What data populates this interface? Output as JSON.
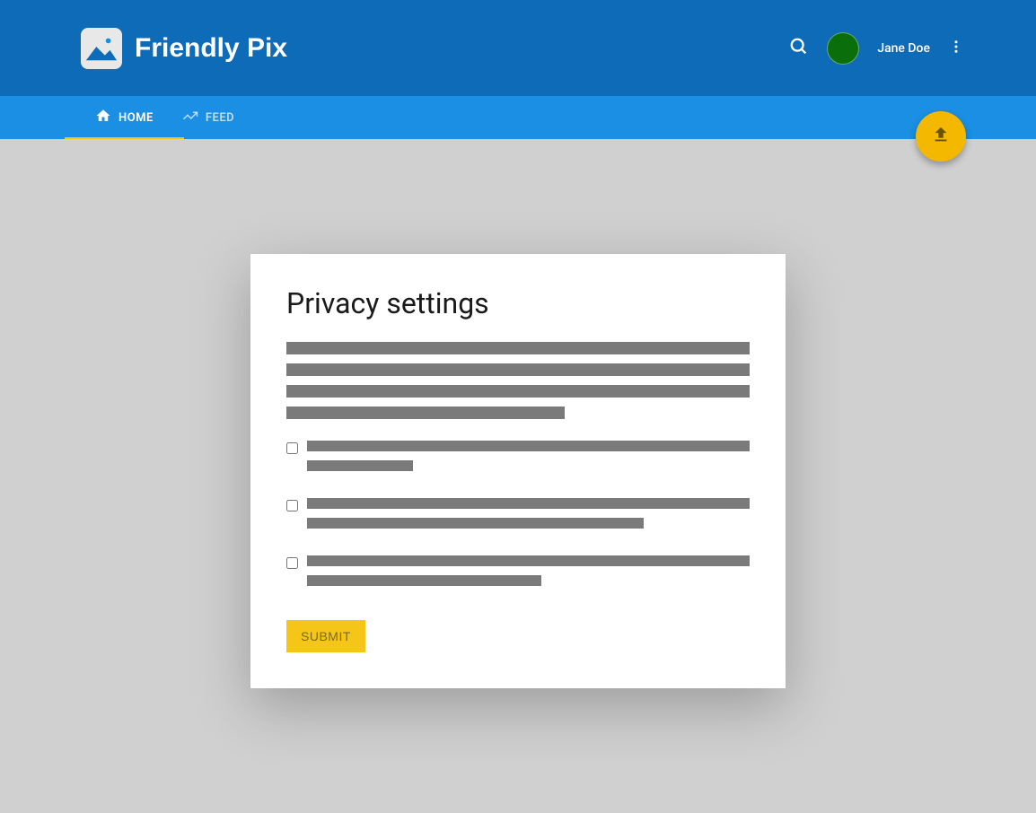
{
  "header": {
    "app_name": "Friendly Pix",
    "user_name": "Jane Doe"
  },
  "tabs": {
    "home": "HOME",
    "feed": "FEED"
  },
  "card": {
    "title": "Privacy settings",
    "submit_label": "SUBMIT"
  }
}
